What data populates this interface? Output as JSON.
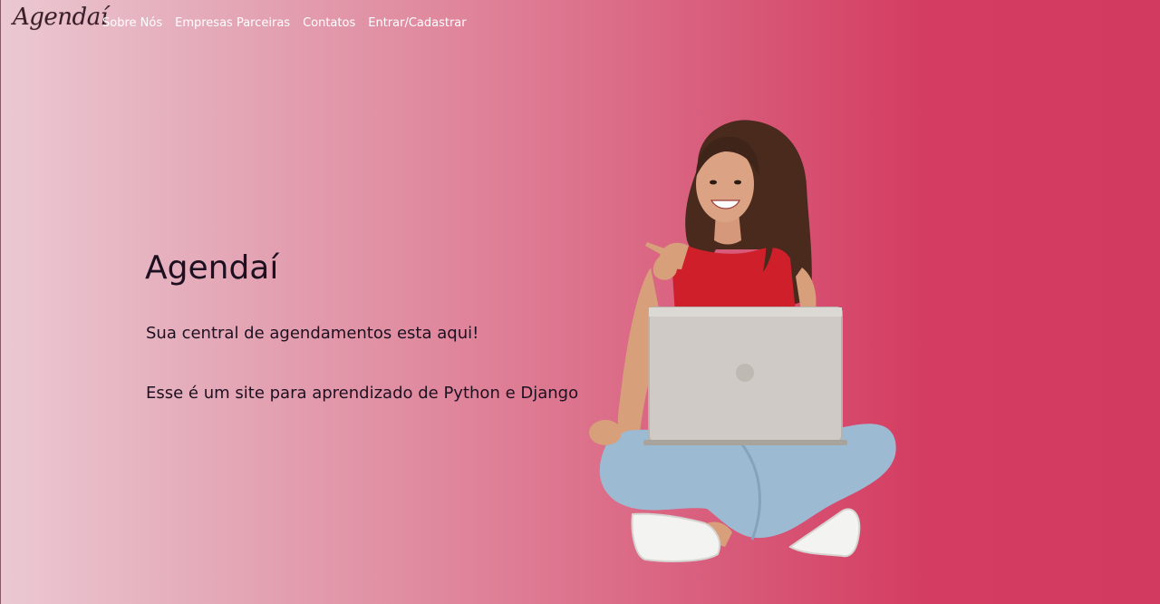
{
  "nav": {
    "brand": "Agendaí",
    "links": [
      {
        "label": "Sobre Nós"
      },
      {
        "label": "Empresas Parceiras"
      },
      {
        "label": "Contatos"
      },
      {
        "label": "Entrar/Cadastrar"
      }
    ]
  },
  "hero": {
    "title": "Agendaí",
    "subtitle": "Sua central de agendamentos esta aqui!",
    "description": "Esse é um site para aprendizado de Python e Django"
  },
  "colors": {
    "gradient_start": "#ebc9d2",
    "gradient_end": "#d33a5f",
    "nav_text": "#ffffff",
    "hero_text": "#1d1020"
  }
}
